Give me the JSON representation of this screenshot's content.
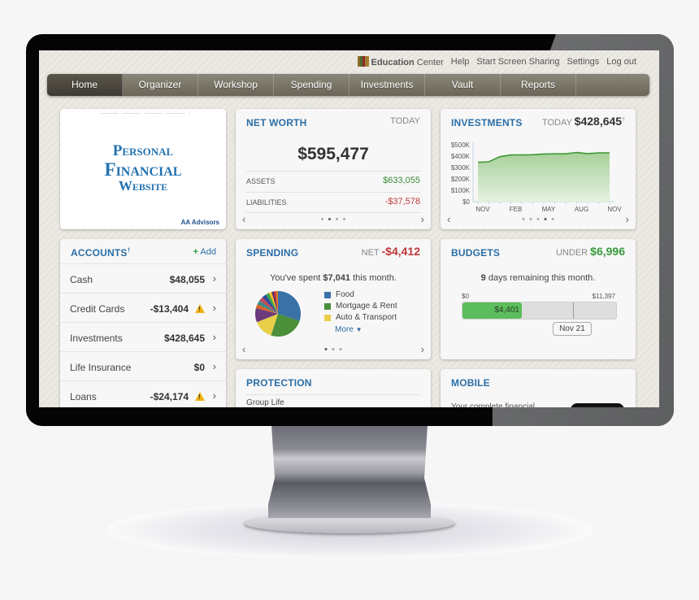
{
  "top_links": {
    "education_center_bold": "Education",
    "education_center_rest": " Center",
    "help": "Help",
    "screen_sharing": "Start Screen Sharing",
    "settings": "Settings",
    "logout": "Log out"
  },
  "nav": {
    "tabs": [
      {
        "label": "Home",
        "active": true
      },
      {
        "label": "Organizer"
      },
      {
        "label": "Workshop"
      },
      {
        "label": "Spending"
      },
      {
        "label": "Investments"
      },
      {
        "label": "Vault"
      },
      {
        "label": "Reports"
      }
    ]
  },
  "logo_card": {
    "line1": "Personal",
    "line2": "Financial",
    "line3": "Website",
    "brand": "AA Advisors"
  },
  "net_worth": {
    "title": "NET WORTH",
    "period": "TODAY",
    "total": "$595,477",
    "assets_label": "ASSETS",
    "assets_value": "$633,055",
    "liabilities_label": "LIABILITIES",
    "liabilities_value": "-$37,578",
    "pager": {
      "count": 4,
      "active": 1
    }
  },
  "investments": {
    "title": "INVESTMENTS",
    "period": "TODAY",
    "value": "$428,645",
    "value_mark": "†",
    "pager": {
      "count": 5,
      "active": 3
    },
    "line_color": "#3e9a34"
  },
  "chart_data": {
    "type": "area",
    "title": "Investments",
    "xlabel": "",
    "ylabel": "",
    "x_tick_labels": [
      "NOV",
      "FEB",
      "MAY",
      "AUG",
      "NOV"
    ],
    "y_tick_labels": [
      "$0",
      "$100K",
      "$200K",
      "$300K",
      "$400K",
      "$500K"
    ],
    "ylim": [
      0,
      500000
    ],
    "x": [
      "Nov",
      "Dec",
      "Jan",
      "Feb",
      "Mar",
      "Apr",
      "May",
      "Jun",
      "Jul",
      "Aug",
      "Sep",
      "Oct",
      "Nov"
    ],
    "series": [
      {
        "name": "Investments",
        "values": [
          345000,
          350000,
          395000,
          410000,
          410000,
          412000,
          418000,
          420000,
          420000,
          432000,
          422000,
          428000,
          428645
        ]
      }
    ],
    "grid": false
  },
  "accounts": {
    "title": "ACCOUNTS",
    "title_mark": "†",
    "add_label": "Add",
    "items": [
      {
        "name": "Cash",
        "amount": "$48,055",
        "warning": false
      },
      {
        "name": "Credit Cards",
        "amount": "-$13,404",
        "warning": true
      },
      {
        "name": "Investments",
        "amount": "$428,645",
        "warning": false
      },
      {
        "name": "Life Insurance",
        "amount": "$0",
        "warning": false
      },
      {
        "name": "Loans",
        "amount": "-$24,174",
        "warning": true
      }
    ]
  },
  "spending": {
    "title": "SPENDING",
    "net_label": "NET",
    "net_value": "-$4,412",
    "msg_pre": "You've spent ",
    "msg_amount": "$7,041",
    "msg_post": " this month.",
    "legend": [
      {
        "label": "Food",
        "color": "#3a72a8"
      },
      {
        "label": "Mortgage & Rent",
        "color": "#4b8f3a"
      },
      {
        "label": "Auto & Transport",
        "color": "#e8cf4a"
      }
    ],
    "more_label": "More",
    "pie": [
      {
        "color": "#3a72a8",
        "pct": 30
      },
      {
        "color": "#4b8f3a",
        "pct": 25
      },
      {
        "color": "#e8cf4a",
        "pct": 14
      },
      {
        "color": "#6b3a7a",
        "pct": 10
      },
      {
        "color": "#d8622a",
        "pct": 3
      },
      {
        "color": "#3a8a8a",
        "pct": 3
      },
      {
        "color": "#c04a5a",
        "pct": 3
      },
      {
        "color": "#2a4a9a",
        "pct": 3
      },
      {
        "color": "#3aa04a",
        "pct": 2.5
      },
      {
        "color": "#f0c020",
        "pct": 2
      },
      {
        "color": "#5a2a6a",
        "pct": 1.5
      },
      {
        "color": "#c03030",
        "pct": 1.5
      },
      {
        "color": "#e07a2a",
        "pct": 1.5
      }
    ],
    "pager": {
      "count": 3,
      "active": 0
    }
  },
  "budgets": {
    "title": "BUDGETS",
    "under_label": "UNDER",
    "under_value": "$6,996",
    "days_num": "9",
    "days_text": " days remaining this month.",
    "min_label": "$0",
    "max_label": "$11,397",
    "spent_label": "$4,401",
    "spent_fraction": 0.386,
    "today_fraction": 0.72,
    "today_label": "Nov 21"
  },
  "protection": {
    "title": "PROTECTION",
    "first_item": "Group Life"
  },
  "mobile": {
    "title": "MOBILE",
    "text": "Your complete financial"
  }
}
